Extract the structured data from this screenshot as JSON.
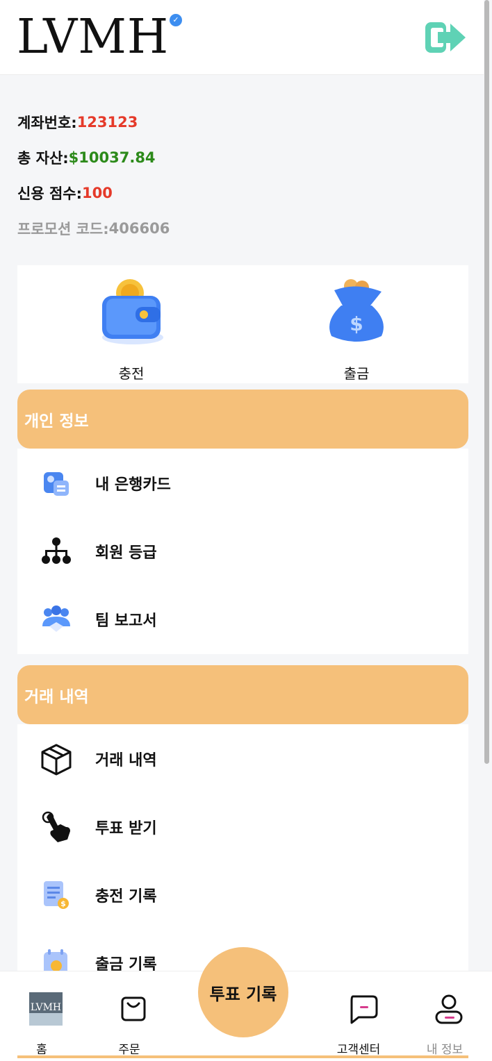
{
  "header": {
    "logo_text": "LVMH",
    "verified_mark": "✓",
    "logout_icon": "logout-icon",
    "accent_color": "#5fd2b5"
  },
  "account": {
    "account_label": "계좌번호:",
    "account_value": "123123",
    "assets_label": "총 자산:",
    "assets_value": "$10037.84",
    "credit_label": "신용 점수:",
    "credit_value": "100",
    "promo_label": "프로모션 코드:",
    "promo_value": "406606"
  },
  "wallet": {
    "recharge_label": "충전",
    "withdraw_label": "출금"
  },
  "personal": {
    "title": "개인 정보",
    "items": [
      {
        "label": "내 은행카드",
        "icon": "bank-card-icon"
      },
      {
        "label": "회원 등급",
        "icon": "org-chart-icon"
      },
      {
        "label": "팀 보고서",
        "icon": "team-handshake-icon"
      }
    ]
  },
  "transactions": {
    "title": "거래 내역",
    "items": [
      {
        "label": "거래 내역",
        "icon": "box-icon"
      },
      {
        "label": "투표 받기",
        "icon": "tap-hand-icon"
      },
      {
        "label": "충전 기록",
        "icon": "recharge-doc-icon"
      },
      {
        "label": "출금 기록",
        "icon": "withdraw-calendar-icon"
      }
    ]
  },
  "tabbar": {
    "home": "홈",
    "orders": "주문",
    "center": "투표 기록",
    "support": "고객센터",
    "profile": "내 정보",
    "center_color": "#f5c07a"
  }
}
